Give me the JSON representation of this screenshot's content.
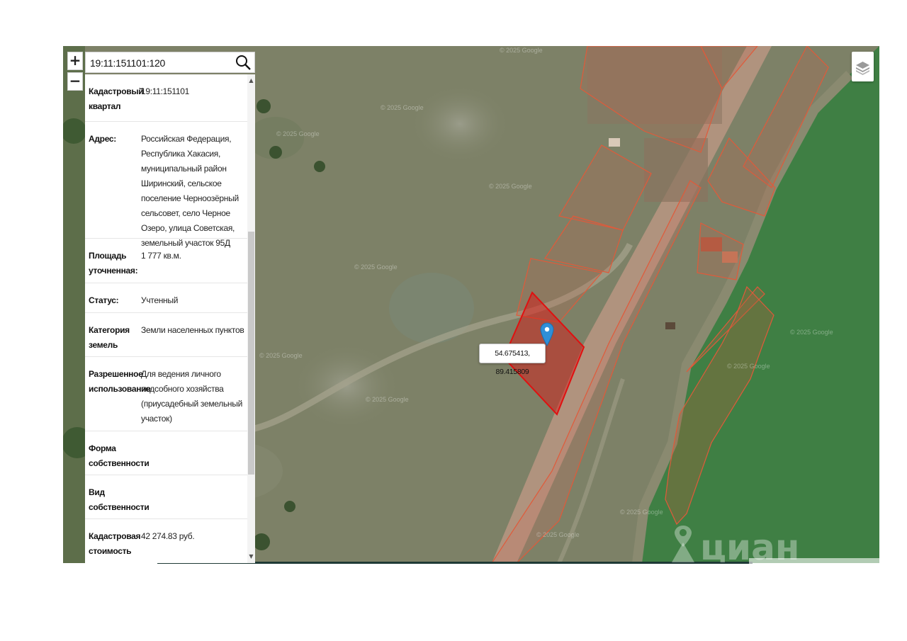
{
  "search": {
    "value": "19:11:151101:120"
  },
  "zoom": {
    "in_label": "+",
    "out_label": "−"
  },
  "parcel_info": [
    {
      "label": "Кадастровый квартал",
      "value": "19:11:151101"
    },
    {
      "label": "Адрес:",
      "value": "Российская Федерация, Республика Хакасия, муниципальный район Ширинский, сельское поселение Черноозёрный сельсовет, село Черное Озеро, улица Советская, земельный участок 95Д"
    },
    {
      "label": "Площадь уточненная:",
      "value": "1 777 кв.м."
    },
    {
      "label": "Статус:",
      "value": "Учтенный"
    },
    {
      "label": "Категория земель",
      "value": "Земли населенных пунктов"
    },
    {
      "label": "Разрешенное использование",
      "value": "Для ведения личного подсобного хозяйства (приусадебный земельный участок)"
    },
    {
      "label": "Форма собственности",
      "value": ""
    },
    {
      "label": "Вид собственности",
      "value": ""
    },
    {
      "label": "Кадастровая стоимость",
      "value": "42 274.83 руб."
    }
  ],
  "map": {
    "coordinates": "54.675413, 89.415809",
    "copyright": "© 2025 Google",
    "watermark": "циан",
    "layers_icon": "layers-icon",
    "pin_icon": "map-pin-icon",
    "highlight_color": "#e01010",
    "parcel_outline_color": "#e05a3a",
    "water_color": "#3f7f44"
  }
}
